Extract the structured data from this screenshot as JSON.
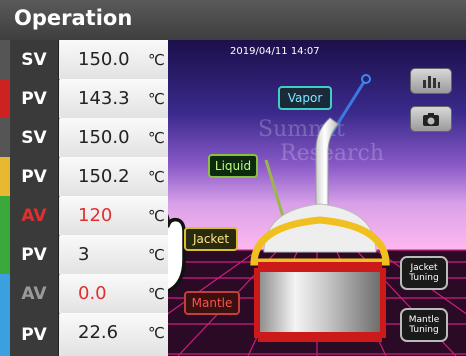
{
  "header": {
    "title": "Operation"
  },
  "rows": [
    {
      "label": "SV",
      "value": "150.0",
      "unit": "℃",
      "stripe": "#555555",
      "label_color": "#ffffff",
      "value_color": "#222222"
    },
    {
      "label": "PV",
      "value": "143.3",
      "unit": "℃",
      "stripe": "#cc2222",
      "label_color": "#ffffff",
      "value_color": "#222222"
    },
    {
      "label": "SV",
      "value": "150.0",
      "unit": "℃",
      "stripe": "#555555",
      "label_color": "#ffffff",
      "value_color": "#222222"
    },
    {
      "label": "PV",
      "value": "150.2",
      "unit": "℃",
      "stripe": "#e8b830",
      "label_color": "#ffffff",
      "value_color": "#222222"
    },
    {
      "label": "AV",
      "value": "120",
      "unit": "℃",
      "stripe": "#3aa83a",
      "label_color": "#e03030",
      "value_color": "#e03030"
    },
    {
      "label": "PV",
      "value": "3",
      "unit": "℃",
      "stripe": "#3aa83a",
      "label_color": "#ffffff",
      "value_color": "#222222"
    },
    {
      "label": "AV",
      "value": "0.0",
      "unit": "℃",
      "stripe": "#3aa0e0",
      "label_color": "#9a9a9a",
      "value_color": "#e03030"
    },
    {
      "label": "PV",
      "value": "22.6",
      "unit": "℃",
      "stripe": "#3aa0e0",
      "label_color": "#ffffff",
      "value_color": "#222222"
    }
  ],
  "scene": {
    "datetime": "2019/04/11 14:07",
    "watermark_line1": "Summit",
    "watermark_line2": "Research",
    "labels": {
      "vapor": "Vapor",
      "liquid": "Liquid",
      "jacket": "Jacket",
      "mantle": "Mantle"
    },
    "buttons": {
      "jacket_tuning": "Jacket Tuning",
      "mantle_tuning": "Mantle Tuning"
    },
    "icons": {
      "chart": "bar-chart-icon",
      "camera": "camera-icon",
      "cursor": "hand-pointer-icon"
    }
  }
}
